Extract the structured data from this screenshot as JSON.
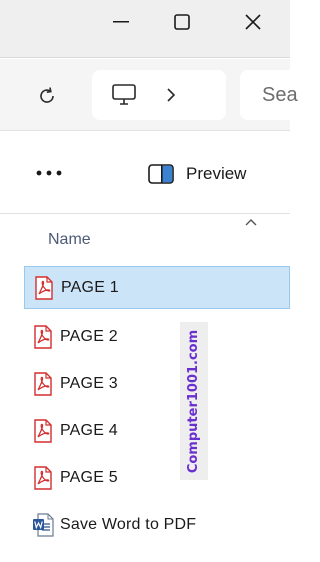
{
  "search": {
    "placeholder": "Sea"
  },
  "commandbar": {
    "more_label": "...",
    "preview_label": "Preview"
  },
  "list": {
    "column_name": "Name",
    "files": [
      {
        "name": "PAGE 1",
        "type": "pdf",
        "selected": true
      },
      {
        "name": "PAGE 2",
        "type": "pdf",
        "selected": false
      },
      {
        "name": "PAGE 3",
        "type": "pdf",
        "selected": false
      },
      {
        "name": "PAGE 4",
        "type": "pdf",
        "selected": false
      },
      {
        "name": "PAGE 5",
        "type": "pdf",
        "selected": false
      },
      {
        "name": "Save Word to PDF",
        "type": "word",
        "selected": false
      }
    ]
  },
  "watermark": {
    "text": "Computer1001.com"
  },
  "colors": {
    "selection": "#cce4f7",
    "pdf_red": "#d32f2f",
    "word_blue": "#2b579a",
    "watermark": "#6a2fd0"
  }
}
